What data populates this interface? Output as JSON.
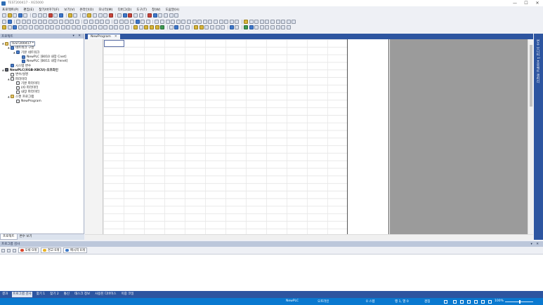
{
  "window": {
    "title": "TEST200417 - XG5000",
    "minimize": "—",
    "maximize": "☐",
    "close": "✕"
  },
  "menu": [
    "프로젝트(P)",
    "편집(E)",
    "찾기/바꾸기(F)",
    "보기(V)",
    "온라인(O)",
    "모니터(M)",
    "디버그(D)",
    "도구(T)",
    "창(W)",
    "도움말(H)"
  ],
  "project_panel": {
    "title": "프로젝트",
    "pin": "▾ ✕",
    "tree": [
      {
        "label": "TEST200417 *",
        "indent": 0,
        "expander": "▲",
        "icon": "project-icon",
        "style": "sel"
      },
      {
        "label": "네트워크 구성",
        "indent": 1,
        "expander": "▲",
        "icon": "network-config-icon"
      },
      {
        "label": "기본 네트워크",
        "indent": 2,
        "expander": "▲",
        "icon": "basic-network-icon"
      },
      {
        "label": "NewPLC [B010 내장 Cnet]",
        "indent": 3,
        "expander": "",
        "icon": "cnet-icon"
      },
      {
        "label": "NewPLC [B011 내장 Fenet]",
        "indent": 3,
        "expander": "",
        "icon": "fenet-icon"
      },
      {
        "label": "시스템 변수",
        "indent": 1,
        "expander": "",
        "icon": "system-variable-icon"
      },
      {
        "label": "NewPLC(XGB-XBCU)-오프라인",
        "indent": 0,
        "expander": "▲",
        "icon": "plc-icon",
        "style": "bold"
      },
      {
        "label": "변수/설명",
        "indent": 1,
        "expander": "",
        "icon": "variable-icon"
      },
      {
        "label": "파라미터",
        "indent": 1,
        "expander": "▲",
        "icon": "parameter-icon"
      },
      {
        "label": "기본 파라미터",
        "indent": 2,
        "expander": "",
        "icon": "basic-parameter-icon"
      },
      {
        "label": "I/O 파라미터",
        "indent": 2,
        "expander": "",
        "icon": "io-parameter-icon"
      },
      {
        "label": "내장 파라미터",
        "indent": 2,
        "expander": "",
        "icon": "builtin-parameter-icon"
      },
      {
        "label": "스캔 프로그램",
        "indent": 1,
        "expander": "▲",
        "icon": "scan-program-icon"
      },
      {
        "label": "NewProgram",
        "indent": 2,
        "expander": "",
        "icon": "program-icon"
      }
    ],
    "tabs": [
      "프로젝트",
      "변수 보기"
    ]
  },
  "editor": {
    "tab_label": "NewProgram",
    "tab_close": "✕"
  },
  "right_dock": {
    "label": "변수 모니터 1 프로젝트 갤러리"
  },
  "output_panel": {
    "title": "프로그램 검사",
    "pin": "▾ ✕",
    "chips": [
      {
        "label": "오류 0개",
        "icon": "error-icon",
        "color": "#d9442c"
      },
      {
        "label": "경고 0개",
        "icon": "warning-icon",
        "color": "#e8b325"
      },
      {
        "label": "메시지 0개",
        "icon": "message-icon",
        "color": "#3b78c8"
      }
    ]
  },
  "bottom_tabs": [
    "결과",
    "프로그램 검사",
    "찾기 1",
    "찾기 2",
    "통신",
    "태스크 정보",
    "사용된 디바이스",
    "이중 코일"
  ],
  "status_bar": {
    "plc": "NewPLC",
    "mode": "오프라인",
    "position": "0 스텝",
    "cursor": "행 1, 열 0",
    "insert": "겹침",
    "zoom": "100%"
  }
}
